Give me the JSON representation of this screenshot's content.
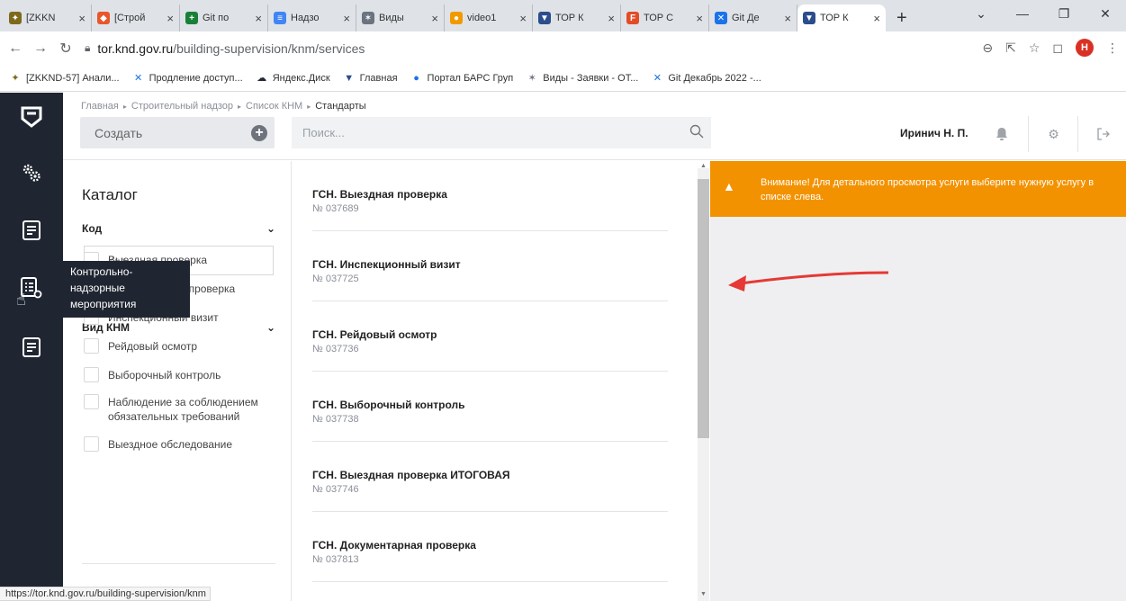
{
  "browser": {
    "tabs": [
      {
        "label": "[ZKKN",
        "color": "#7d6a1d",
        "glyph": "✦"
      },
      {
        "label": "[Строй",
        "color": "#e8562a",
        "glyph": "◆"
      },
      {
        "label": "Git по",
        "color": "#188038",
        "glyph": "+"
      },
      {
        "label": "Надзо",
        "color": "#4285f4",
        "glyph": "≡"
      },
      {
        "label": "Виды",
        "color": "#6b7280",
        "glyph": "✶"
      },
      {
        "label": "video1",
        "color": "#f29900",
        "glyph": "●"
      },
      {
        "label": "ТОР К",
        "color": "#2b4d8c",
        "glyph": "▼"
      },
      {
        "label": "ТОР С",
        "color": "#e34c26",
        "glyph": "F"
      },
      {
        "label": "Git Де",
        "color": "#1a73e8",
        "glyph": "✕"
      },
      {
        "label": "ТОР К",
        "color": "#2b4d8c",
        "glyph": "▼"
      }
    ],
    "url_host": "tor.knd.gov.ru",
    "url_path": "/building-supervision/knm/services",
    "profile_initial": "Н",
    "bookmarks": [
      {
        "label": "[ZKKND-57] Анали...",
        "icon": "jira-icon",
        "color": "#7d6a1d",
        "glyph": "✦"
      },
      {
        "label": "Продление доступ...",
        "icon": "confluence-icon",
        "color": "#1a73e8",
        "glyph": "✕"
      },
      {
        "label": "Яндекс.Диск",
        "icon": "cloud-icon",
        "color": "#1f2937",
        "glyph": "☁"
      },
      {
        "label": "Главная",
        "icon": "tor-icon",
        "color": "#2b4d8c",
        "glyph": "▼"
      },
      {
        "label": "Портал БАРС Груп",
        "icon": "bars-icon",
        "color": "#1a73e8",
        "glyph": "●"
      },
      {
        "label": "Виды - Заявки - ОТ...",
        "icon": "star-icon",
        "color": "#6b7280",
        "glyph": "✶"
      },
      {
        "label": "Git Декабрь 2022 -...",
        "icon": "confluence-icon",
        "color": "#1a73e8",
        "glyph": "✕"
      }
    ],
    "status_url": "https://tor.knd.gov.ru/building-supervision/knm"
  },
  "header": {
    "breadcrumb": [
      "Главная",
      "Строительный надзор",
      "Список КНМ",
      "Стандарты"
    ],
    "create_label": "Создать",
    "search_placeholder": "Поиск...",
    "user_name": "Иринич Н. П."
  },
  "sidebar": {
    "tooltip": "Контрольно-надзорные мероприятия"
  },
  "catalog": {
    "title": "Каталог",
    "code_section": "Код",
    "code_placeholder": "Код",
    "type_section": "Вид КНМ",
    "filters": [
      "Выездная проверка",
      "Документарная проверка",
      "Инспекционный визит",
      "Рейдовый осмотр",
      "Выборочный контроль",
      "Наблюдение за соблюдением обязательных требований",
      "Выездное обследование"
    ]
  },
  "services": [
    {
      "name": "ГСН. Выездная проверка",
      "number": "№ 037689"
    },
    {
      "name": "ГСН. Инспекционный визит",
      "number": "№ 037725"
    },
    {
      "name": "ГСН. Рейдовый осмотр",
      "number": "№ 037736"
    },
    {
      "name": "ГСН. Выборочный контроль",
      "number": "№ 037738"
    },
    {
      "name": "ГСН. Выездная проверка ИТОГОВАЯ",
      "number": "№ 037746"
    },
    {
      "name": "ГСН. Документарная проверка",
      "number": "№ 037813"
    }
  ],
  "detail": {
    "alert": "Внимание! Для детального просмотра услуги выберите нужную услугу в списке слева."
  }
}
